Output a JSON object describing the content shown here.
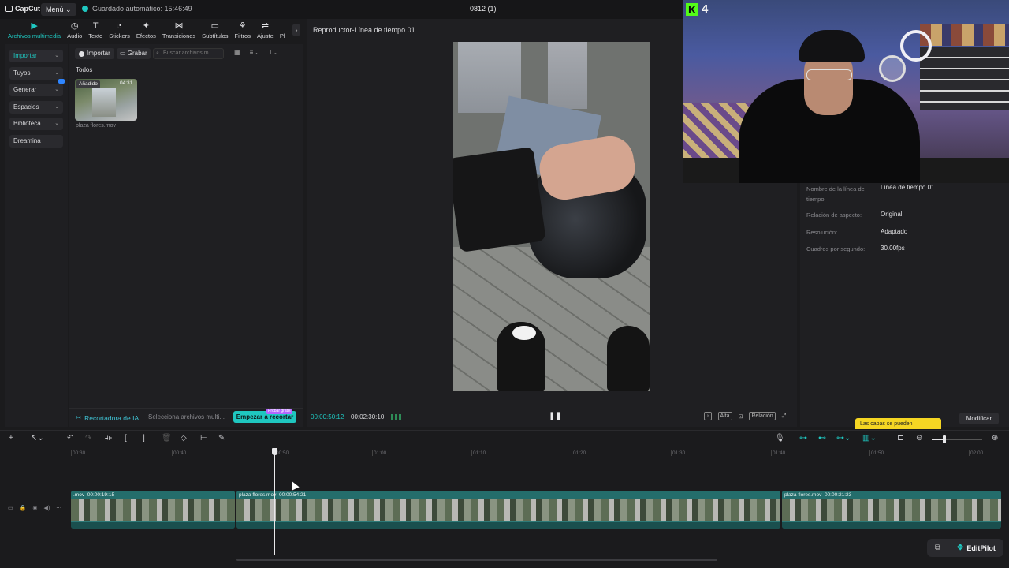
{
  "topbar": {
    "logo": "CapCut",
    "menu_label": "Menú",
    "autosave": "Guardado automático: 15:46:49",
    "project_name": "0812 (1)"
  },
  "tool_tabs": [
    {
      "label": "Archivos multimedia",
      "icon": "media-icon",
      "glyph": "▶",
      "active": true
    },
    {
      "label": "Audio",
      "icon": "audio-icon",
      "glyph": "◷",
      "active": false
    },
    {
      "label": "Texto",
      "icon": "text-icon",
      "glyph": "T",
      "active": false
    },
    {
      "label": "Stickers",
      "icon": "sticker-icon",
      "glyph": "◔",
      "active": false
    },
    {
      "label": "Efectos",
      "icon": "effects-icon",
      "glyph": "✦",
      "active": false
    },
    {
      "label": "Transiciones",
      "icon": "transition-icon",
      "glyph": "⋈",
      "active": false
    },
    {
      "label": "Subtítulos",
      "icon": "subtitle-icon",
      "glyph": "▭",
      "active": false
    },
    {
      "label": "Filtros",
      "icon": "filter-icon",
      "glyph": "⚘",
      "active": false
    },
    {
      "label": "Ajuste",
      "icon": "adjust-icon",
      "glyph": "⇌",
      "active": false
    },
    {
      "label": "Pl",
      "icon": "plugin-icon",
      "glyph": "",
      "active": false
    }
  ],
  "left_nav": [
    {
      "label": "Importar",
      "active": true
    },
    {
      "label": "Tuyos",
      "active": false
    },
    {
      "label": "Generar",
      "active": false,
      "badge": true
    },
    {
      "label": "Espacios",
      "active": false
    },
    {
      "label": "Biblioteca",
      "active": false
    },
    {
      "label": "Dreamina",
      "active": false
    }
  ],
  "media": {
    "import_label": "Importar",
    "record_label": "Grabar",
    "search_placeholder": "Buscar archivos m...",
    "section_title": "Todos",
    "item": {
      "added_label": "Añadido",
      "duration": "04:31",
      "name": "plaza flores.mov"
    }
  },
  "ai_bar": {
    "title": "Recortadora de IA",
    "hint": "Selecciona archivos multi...",
    "start_label": "Empezar a recortar",
    "free_badge": "Probar gratis"
  },
  "player": {
    "title": "Reproductor-Línea de tiempo 01",
    "current_time": "00:00:50:12",
    "total_time": "00:02:30:10",
    "tool_alta": "Alta",
    "tool_relacion": "Relación"
  },
  "overlay": {
    "kick_logo": "K",
    "kick_count": "4"
  },
  "details": {
    "rows": [
      {
        "label": "Nombre de la línea de tiempo",
        "value": "Línea de tiempo 01"
      },
      {
        "label": "Relación de aspecto:",
        "value": "Original"
      },
      {
        "label": "Resolución:",
        "value": "Adaptado"
      },
      {
        "label": "Cuadros por segundo:",
        "value": "30.00fps"
      }
    ],
    "tooltip": "Las capas se pueden",
    "modify_label": "Modificar"
  },
  "timeline": {
    "ticks": [
      "00:30",
      "00:40",
      "00:50",
      "01:00",
      "01:10",
      "01:20",
      "01:30",
      "01:40",
      "01:50",
      "02:00"
    ],
    "clips": [
      {
        "name": ".mov",
        "duration": "00:00:19:15"
      },
      {
        "name": "plaza flores.mov",
        "duration": "00:00:54:21"
      },
      {
        "name": "plaza flores.mov",
        "duration": "00:00:21:23"
      }
    ]
  },
  "editpilot": {
    "label": "EditPilot"
  }
}
